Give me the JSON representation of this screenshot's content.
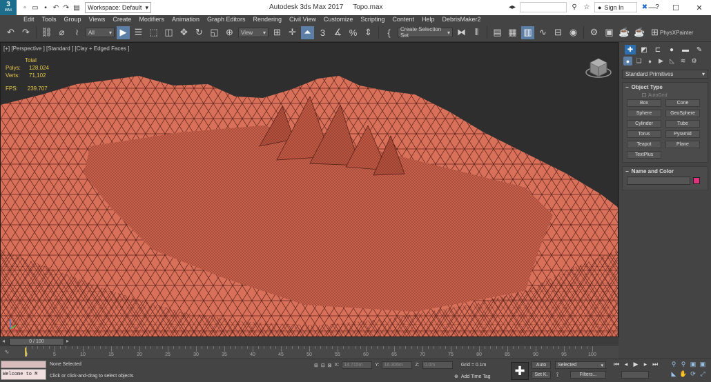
{
  "app": {
    "logo_text": "3",
    "logo_sub": "MAX",
    "title": "Autodesk 3ds Max 2017",
    "file": "Topo.max"
  },
  "workspace": "Workspace: Default",
  "titlebar": {
    "sign_in": "Sign In"
  },
  "menu": [
    "Edit",
    "Tools",
    "Group",
    "Views",
    "Create",
    "Modifiers",
    "Animation",
    "Graph Editors",
    "Rendering",
    "Civil View",
    "Customize",
    "Scripting",
    "Content",
    "Help",
    "DebrisMaker2"
  ],
  "toolbar": {
    "filter": "All",
    "ref_coord": "View",
    "selection_set": "Create Selection Set",
    "angle_snap": "3",
    "physx": "PhysXPainter"
  },
  "viewport": {
    "label": "[+] [Perspective ] [Standard ] [Clay + Edged Faces ]",
    "total_label": "Total",
    "polys_label": "Polys:",
    "polys": "128,024",
    "verts_label": "Verts:",
    "verts": "71,102",
    "fps_label": "FPS:",
    "fps": "239.707"
  },
  "command_panel": {
    "dropdown": "Standard Primitives",
    "object_type_title": "Object Type",
    "autogrid": "AutoGrid",
    "buttons": [
      "Box",
      "Cone",
      "Sphere",
      "GeoSphere",
      "Cylinder",
      "Tube",
      "Torus",
      "Pyramid",
      "Teapot",
      "Plane",
      "TextPlus"
    ],
    "name_color_title": "Name and Color",
    "object_color": "#e0317a"
  },
  "timeline": {
    "frame": "0 / 100",
    "ticks": [
      "0",
      "5",
      "10",
      "15",
      "20",
      "25",
      "30",
      "35",
      "40",
      "45",
      "50",
      "55",
      "60",
      "65",
      "70",
      "75",
      "80",
      "85",
      "90",
      "95",
      "100"
    ]
  },
  "status": {
    "selection": "None Selected",
    "prompt": "Click or click-and-drag to select objects",
    "maxscript": "Welcome to M",
    "x_label": "X:",
    "x": "14.715m",
    "y_label": "Y:",
    "y": "16.306m",
    "z_label": "Z:",
    "z": "0.0m",
    "grid": "Grid = 0.1m",
    "add_time_tag": "Add Time Tag",
    "auto": "Auto",
    "set_key": "Set K.",
    "selected": "Selected",
    "filters": "Filters..."
  },
  "colors": {
    "terrain": "#d9705a",
    "mesh": "#5a2219",
    "accent": "#5d7fa6",
    "tab_active": "#2b6fb0"
  }
}
